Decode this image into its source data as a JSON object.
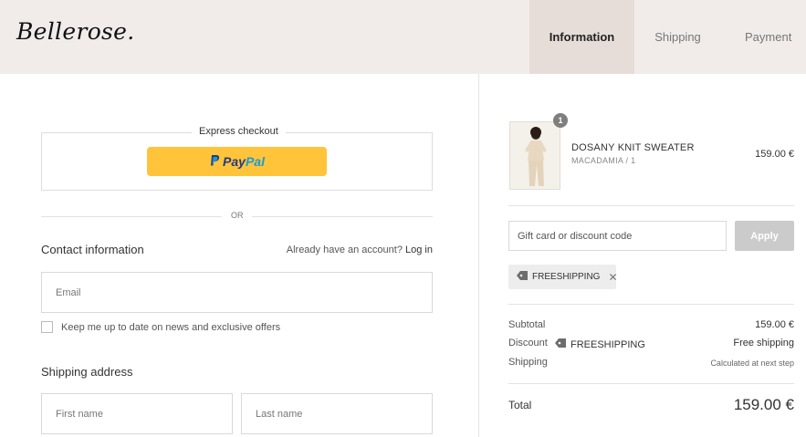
{
  "brand": {
    "logo_text": "Bellerose."
  },
  "steps": [
    {
      "label": "Information",
      "active": true
    },
    {
      "label": "Shipping",
      "active": false
    },
    {
      "label": "Payment",
      "active": false
    }
  ],
  "express": {
    "label": "Express checkout",
    "paypal_pay": "Pay",
    "paypal_pal": "Pal",
    "or_text": "OR"
  },
  "contact": {
    "title": "Contact information",
    "account_prompt": "Already have an account?",
    "login_link": "Log in",
    "email_placeholder": "Email",
    "newsletter_label": "Keep me up to date on news and exclusive offers"
  },
  "shipping_address": {
    "title": "Shipping address",
    "first_name_placeholder": "First name",
    "last_name_placeholder": "Last name"
  },
  "cart": {
    "items": [
      {
        "quantity": "1",
        "name": "DOSANY KNIT SWEATER",
        "variant": "MACADAMIA / 1",
        "price": "159.00 €"
      }
    ]
  },
  "discount": {
    "placeholder": "Gift card or discount code",
    "apply_label": "Apply",
    "applied_code": "FREESHIPPING"
  },
  "summary": {
    "subtotal_label": "Subtotal",
    "subtotal_value": "159.00 €",
    "discount_label": "Discount",
    "discount_code": "FREESHIPPING",
    "discount_value": "Free shipping",
    "shipping_label": "Shipping",
    "shipping_value": "Calculated at next step",
    "total_label": "Total",
    "total_value": "159.00 €"
  },
  "colors": {
    "header_bg": "#f1ecea",
    "active_step_bg": "#e6ddd9",
    "paypal_yellow": "#ffc439",
    "paypal_dark_blue": "#253b80",
    "paypal_light_blue": "#179bd7",
    "apply_disabled": "#cbcbcb"
  },
  "icons": {
    "discount_tag": "tag-icon",
    "remove_code": "close-icon",
    "paypal_logo": "paypal-icon"
  }
}
